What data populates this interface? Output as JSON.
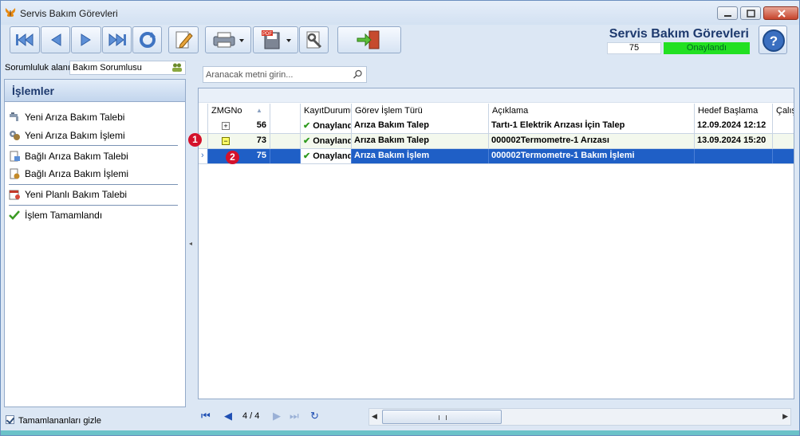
{
  "window": {
    "title": "Servis Bakım Görevleri"
  },
  "header": {
    "title": "Servis Bakım Görevleri",
    "number": "75",
    "status": "Onaylandı",
    "status_color": "#22e022"
  },
  "toolbar": {
    "icons": [
      "first-icon",
      "previous-icon",
      "next-icon",
      "last-icon",
      "refresh-icon",
      "edit-icon",
      "print-icon",
      "pdf-export-icon",
      "settings-icon",
      "exit-icon",
      "help-icon"
    ]
  },
  "sidebar": {
    "responsibility_label": "Sorumluluk alanı",
    "responsibility_value": "Bakım Sorumlusu",
    "panel_title": "İşlemler",
    "items": [
      {
        "label": "Yeni Arıza Bakım Talebi"
      },
      {
        "label": "Yeni Arıza Bakım İşlemi"
      },
      {
        "label": "Bağlı Arıza Bakım Talebi"
      },
      {
        "label": "Bağlı Arıza Bakım İşlemi"
      },
      {
        "label": "Yeni Planlı Bakım Talebi"
      },
      {
        "label": "İşlem Tamamlandı"
      }
    ],
    "hide_completed_label": "Tamamlananları gizle",
    "hide_completed_checked": true
  },
  "search": {
    "placeholder": "Aranacak metni girin..."
  },
  "table": {
    "columns": [
      "ZMGNo",
      "KayıtDurumu",
      "Görev İşlem Türü",
      "Açıklama",
      "Hedef Başlama",
      "Çalış"
    ],
    "rows": [
      {
        "expander": "+",
        "no": "56",
        "status": "Onaylandı",
        "type": "Arıza Bakım Talep",
        "desc": "Tartı-1 Elektrik Arızası İçin Talep",
        "start": "12.09.2024 12:12"
      },
      {
        "expander": "−",
        "no": "73",
        "status": "Onaylandı",
        "type": "Arıza Bakım Talep",
        "desc": "000002Termometre-1 Arızası",
        "start": "13.09.2024 15:20"
      },
      {
        "expander": "",
        "no": "75",
        "status": "Onaylandı",
        "type": "Arıza Bakım İşlem",
        "desc": "000002Termometre-1 Bakım İşlemi",
        "start": ""
      }
    ],
    "selected_row": 2
  },
  "annotations": [
    {
      "label": "1"
    },
    {
      "label": "2"
    }
  ],
  "pager": {
    "text": "4 / 4"
  }
}
